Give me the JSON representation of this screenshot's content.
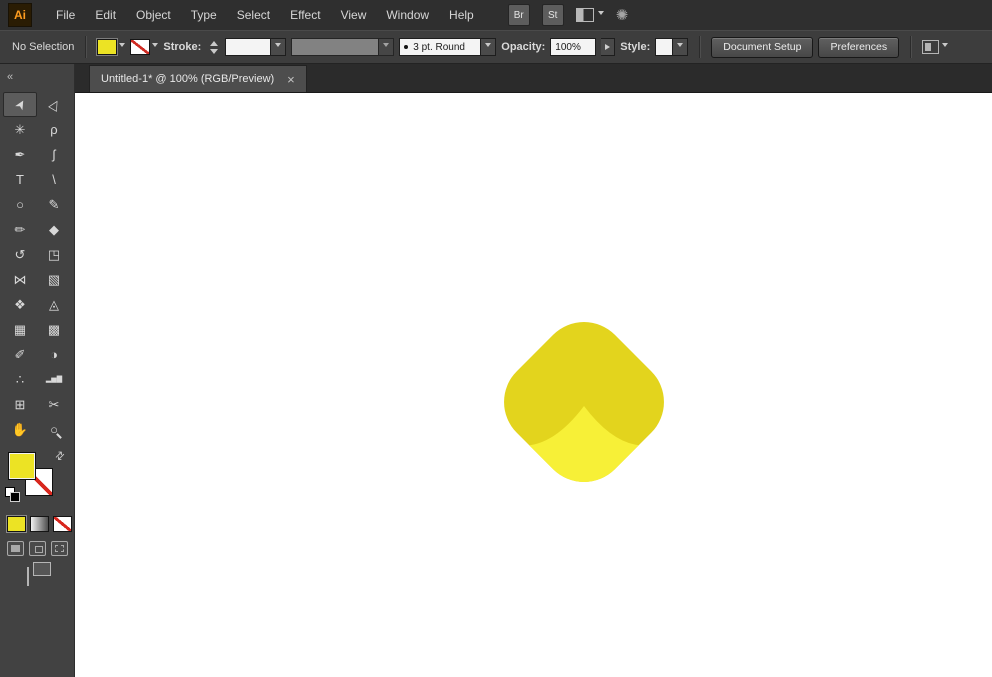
{
  "menubar": {
    "logo": "Ai",
    "items": [
      {
        "label": "File"
      },
      {
        "label": "Edit"
      },
      {
        "label": "Object"
      },
      {
        "label": "Type"
      },
      {
        "label": "Select"
      },
      {
        "label": "Effect"
      },
      {
        "label": "View"
      },
      {
        "label": "Window"
      },
      {
        "label": "Help"
      }
    ],
    "bridge": "Br",
    "stock": "St",
    "sync_glyph": "✺"
  },
  "controlbar": {
    "no_selection": "No Selection",
    "stroke_label": "Stroke:",
    "brush_label": "3 pt. Round",
    "opacity_label": "Opacity:",
    "opacity_value": "100%",
    "style_label": "Style:",
    "document_setup": "Document Setup",
    "preferences": "Preferences"
  },
  "tabbar": {
    "title": "Untitled-1* @ 100% (RGB/Preview)",
    "close_glyph": "×"
  },
  "toolbar": {
    "collapse_glyph": "«",
    "swap_glyph": "⇄",
    "tools": [
      {
        "name": "selection-tool",
        "glyph": "➤"
      },
      {
        "name": "direct-selection-tool",
        "glyph": "▷"
      },
      {
        "name": "magic-wand-tool",
        "glyph": "✳"
      },
      {
        "name": "lasso-tool",
        "glyph": "ρ"
      },
      {
        "name": "pen-tool",
        "glyph": "✒"
      },
      {
        "name": "curvature-tool",
        "glyph": "ʃ"
      },
      {
        "name": "type-tool",
        "glyph": "T"
      },
      {
        "name": "line-segment-tool",
        "glyph": "\\"
      },
      {
        "name": "ellipse-tool",
        "glyph": "○"
      },
      {
        "name": "paintbrush-tool",
        "glyph": "✎"
      },
      {
        "name": "pencil-tool",
        "glyph": "✏"
      },
      {
        "name": "eraser-tool",
        "glyph": "◆"
      },
      {
        "name": "rotate-tool",
        "glyph": "↺"
      },
      {
        "name": "scale-tool",
        "glyph": "◳"
      },
      {
        "name": "width-tool",
        "glyph": "⋈"
      },
      {
        "name": "free-transform-tool",
        "glyph": "▧"
      },
      {
        "name": "shape-builder-tool",
        "glyph": "❖"
      },
      {
        "name": "perspective-grid-tool",
        "glyph": "◬"
      },
      {
        "name": "mesh-tool",
        "glyph": "▦"
      },
      {
        "name": "gradient-tool",
        "glyph": "▩"
      },
      {
        "name": "eyedropper-tool",
        "glyph": "✐"
      },
      {
        "name": "blend-tool",
        "glyph": "◑"
      },
      {
        "name": "symbol-sprayer-tool",
        "glyph": "∴"
      },
      {
        "name": "column-graph-tool",
        "glyph": "▂▅▇"
      },
      {
        "name": "artboard-tool",
        "glyph": "⊞"
      },
      {
        "name": "slice-tool",
        "glyph": "✂"
      },
      {
        "name": "hand-tool",
        "glyph": "✋"
      },
      {
        "name": "zoom-tool",
        "glyph": "○"
      }
    ]
  },
  "canvas": {
    "shape": {
      "top_color": "#e3d41d",
      "bottom_color": "#f7f037"
    }
  },
  "colors": {
    "fill_swatch": "#ece324",
    "none_red": "#d8271e",
    "ui_dark": "#2f2f2f",
    "ui_mid": "#424242"
  }
}
